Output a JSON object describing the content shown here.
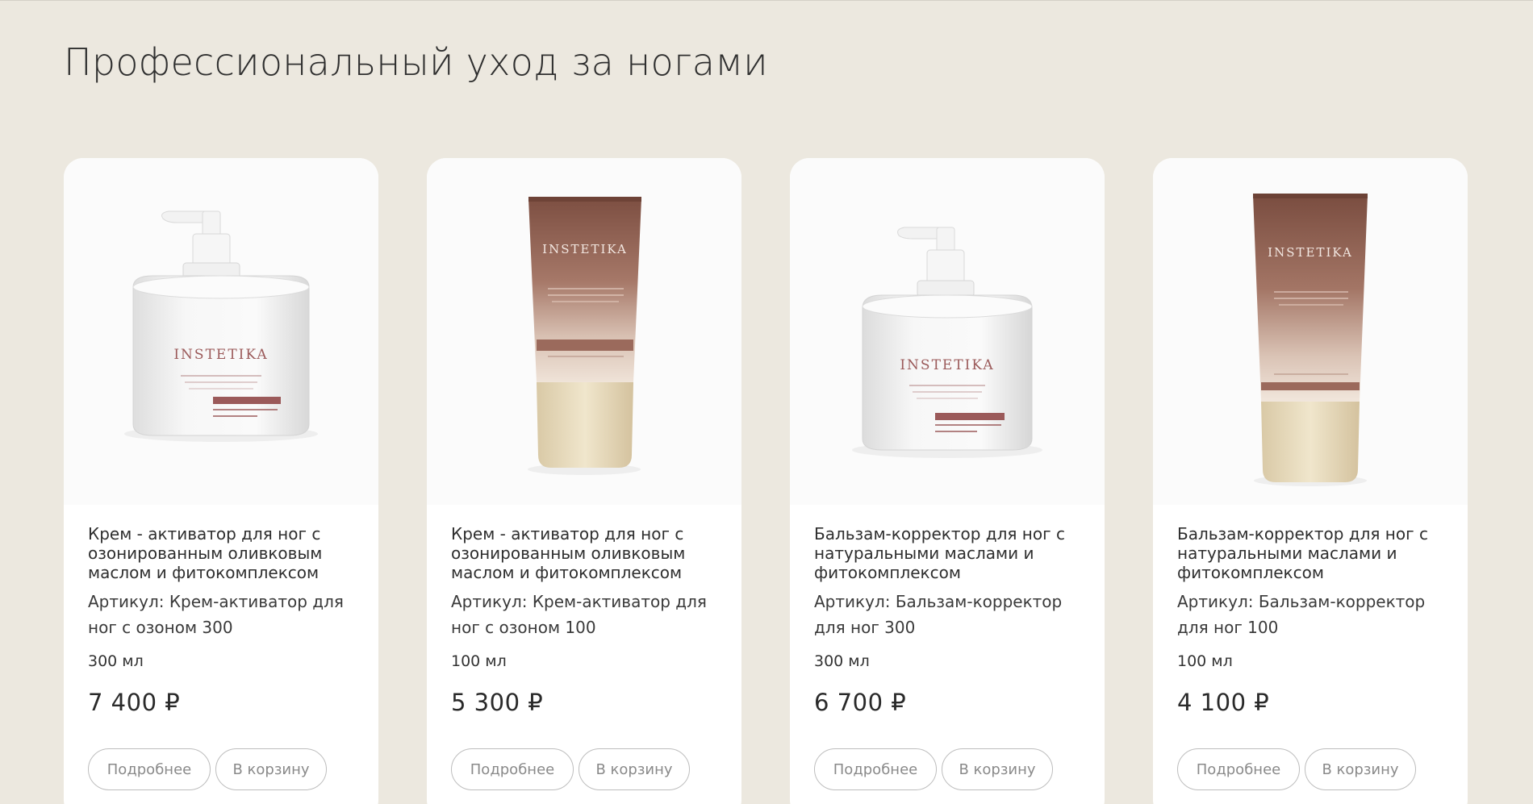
{
  "section": {
    "title": "Профессиональный уход за ногами"
  },
  "brand": "INSTETIKA",
  "currency": "₽",
  "products": [
    {
      "name": "Крем - активатор для ног с озонированным оливковым маслом и фитокомплексом",
      "sku": "Артикул: Крем-активатор для ног с озоном 300",
      "volume": "300 мл",
      "price": "7 400 ₽",
      "package": "jar",
      "details_label": "Подробнее",
      "cart_label": "В корзину"
    },
    {
      "name": "Крем - активатор для ног с озонированным оливковым маслом и фитокомплексом",
      "sku": "Артикул: Крем-активатор для ног с озоном 100",
      "volume": "100 мл",
      "price": "5 300 ₽",
      "package": "tube",
      "details_label": "Подробнее",
      "cart_label": "В корзину"
    },
    {
      "name": "Бальзам-корректор для ног с натуральными маслами и фитокомплексом",
      "sku": "Артикул: Бальзам-корректор для ног 300",
      "volume": "300 мл",
      "price": "6 700 ₽",
      "package": "jar",
      "details_label": "Подробнее",
      "cart_label": "В корзину"
    },
    {
      "name": "Бальзам-корректор для ног с натуральными маслами и фитокомплексом",
      "sku": "Артикул: Бальзам-корректор для ног 100",
      "volume": "100 мл",
      "price": "4 100 ₽",
      "package": "tube",
      "details_label": "Подробнее",
      "cart_label": "В корзину"
    }
  ],
  "colors": {
    "page_bg": "#ece8df",
    "card_bg": "#ffffff",
    "tube_brown": "#8c5d4e",
    "tube_cap": "#e8dcc0",
    "label_accent": "#9b5a5a"
  }
}
